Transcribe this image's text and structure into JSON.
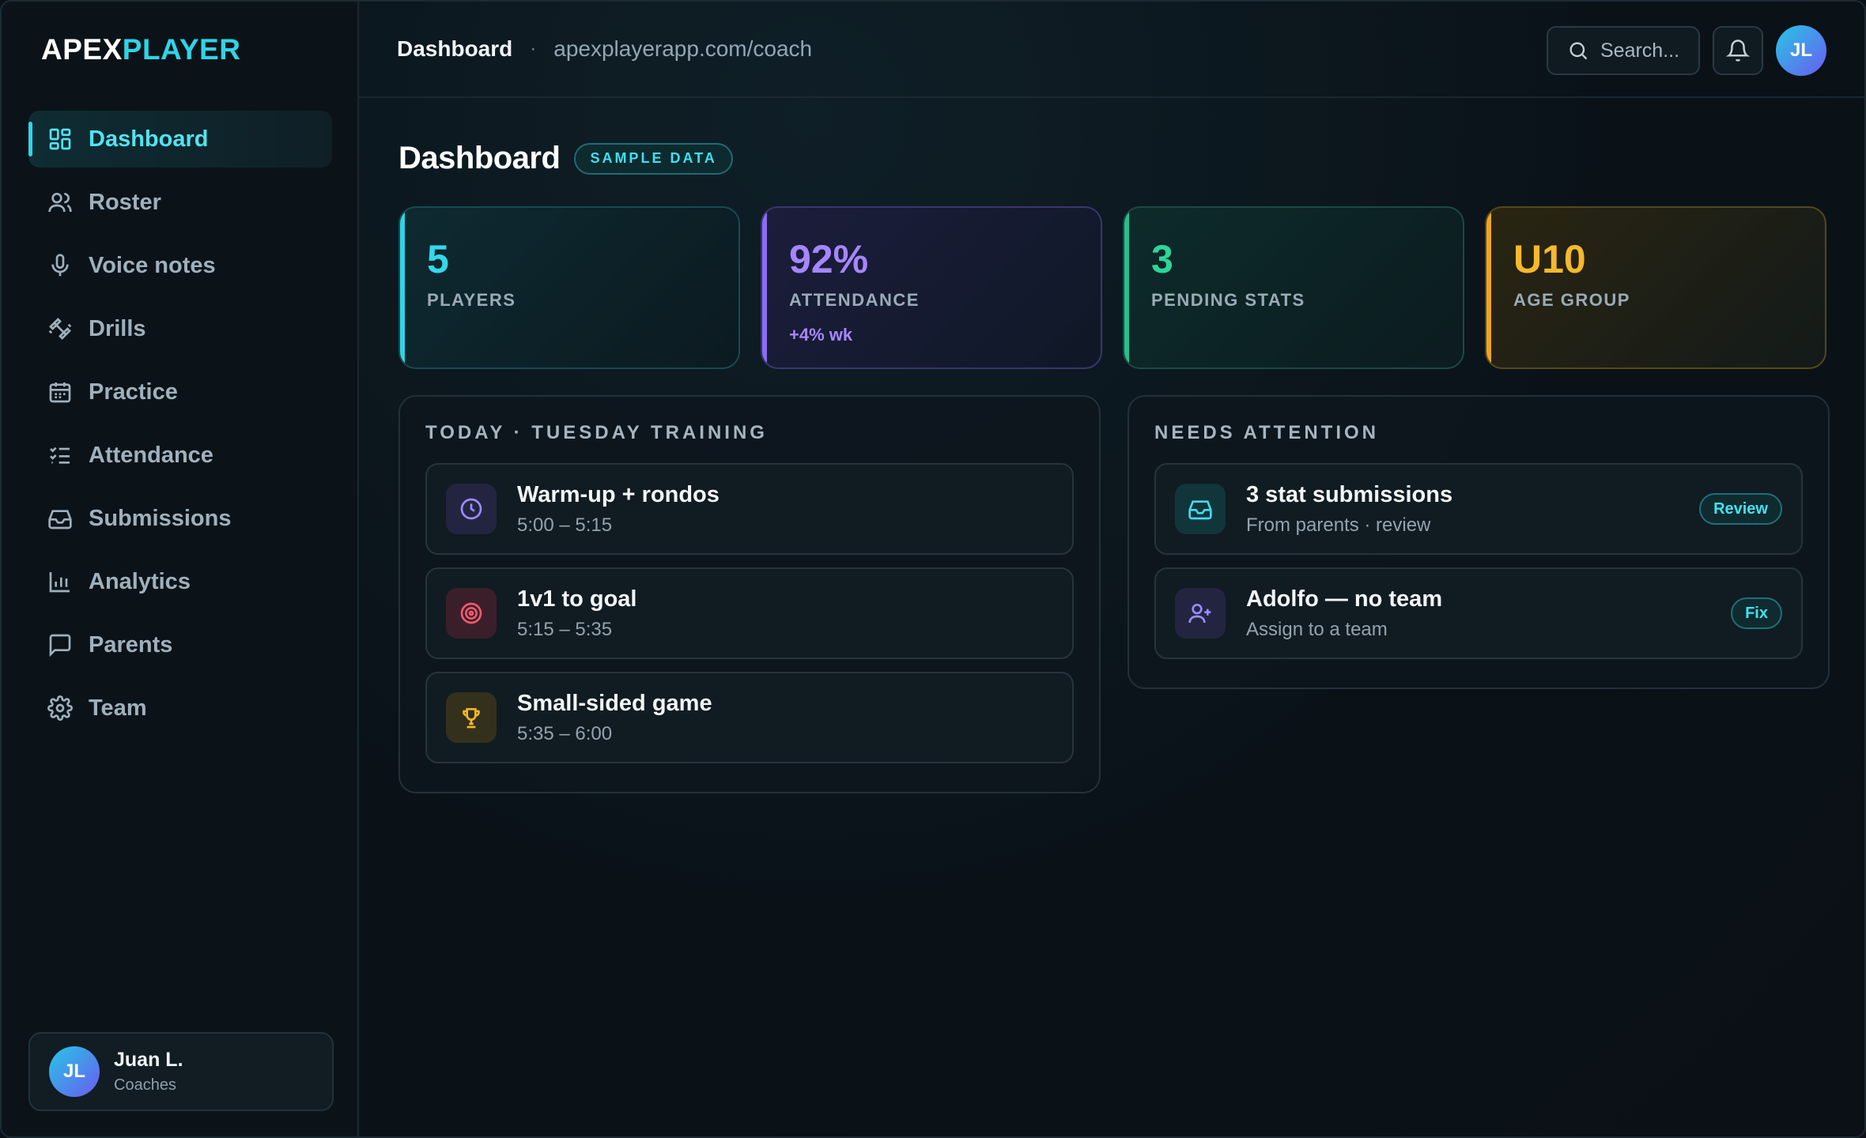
{
  "brand": {
    "part1": "APEX",
    "part2": "PLAYER"
  },
  "sidebar": {
    "items": [
      {
        "label": "Dashboard",
        "icon": "dashboard-icon",
        "active": true
      },
      {
        "label": "Roster",
        "icon": "users-icon"
      },
      {
        "label": "Voice notes",
        "icon": "microphone-icon"
      },
      {
        "label": "Drills",
        "icon": "dumbbell-icon"
      },
      {
        "label": "Practice",
        "icon": "calendar-icon"
      },
      {
        "label": "Attendance",
        "icon": "checklist-icon"
      },
      {
        "label": "Submissions",
        "icon": "inbox-icon"
      },
      {
        "label": "Analytics",
        "icon": "bar-chart-icon"
      },
      {
        "label": "Parents",
        "icon": "message-icon"
      },
      {
        "label": "Team",
        "icon": "gear-icon"
      }
    ],
    "user": {
      "initials": "JL",
      "name": "Juan L.",
      "role": "Coaches"
    }
  },
  "topbar": {
    "title": "Dashboard",
    "separator": "·",
    "url": "apexplayerapp.com/coach",
    "search_placeholder": "Search...",
    "avatar_initials": "JL"
  },
  "page": {
    "title": "Dashboard",
    "badge": "SAMPLE DATA"
  },
  "stats": [
    {
      "value": "5",
      "label": "PLAYERS",
      "color": "#35d8ea"
    },
    {
      "value": "92%",
      "label": "ATTENDANCE",
      "delta": "+4% wk",
      "color": "#a686ff"
    },
    {
      "value": "3",
      "label": "PENDING STATS",
      "color": "#2fd59a"
    },
    {
      "value": "U10",
      "label": "AGE GROUP",
      "color": "#f6b92c"
    }
  ],
  "today": {
    "title": "TODAY · TUESDAY TRAINING",
    "items": [
      {
        "title": "Warm-up + rondos",
        "time": "5:00 – 5:15",
        "icon": "clock-icon"
      },
      {
        "title": "1v1 to goal",
        "time": "5:15 – 5:35",
        "icon": "target-icon"
      },
      {
        "title": "Small-sided game",
        "time": "5:35 – 6:00",
        "icon": "trophy-icon"
      }
    ]
  },
  "attention": {
    "title": "NEEDS ATTENTION",
    "items": [
      {
        "title": "3 stat submissions",
        "sub": "From parents · review",
        "action": "Review",
        "icon": "inbox-icon"
      },
      {
        "title": "Adolfo — no team",
        "sub": "Assign to a team",
        "action": "Fix",
        "icon": "user-plus-icon"
      }
    ]
  }
}
